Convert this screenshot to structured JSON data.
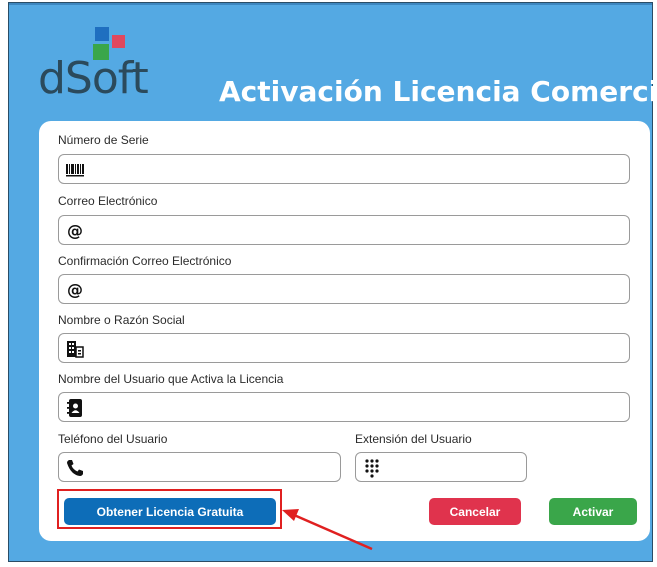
{
  "header": {
    "logo_text": "dSoft",
    "title": "Activación Licencia Comercial"
  },
  "form": {
    "serial": {
      "label": "Número de Serie",
      "value": "",
      "icon": "barcode-icon"
    },
    "email": {
      "label": "Correo Electrónico",
      "value": "",
      "icon": "at-icon"
    },
    "email_confirm": {
      "label": "Confirmación Correo Electrónico",
      "value": "",
      "icon": "at-icon"
    },
    "company": {
      "label": "Nombre o Razón Social",
      "value": "",
      "icon": "building-icon"
    },
    "user_name": {
      "label": "Nombre del Usuario que Activa la Licencia",
      "value": "",
      "icon": "address-book-icon"
    },
    "phone": {
      "label": "Teléfono del Usuario",
      "value": "",
      "icon": "phone-icon"
    },
    "extension": {
      "label": "Extensión del Usuario",
      "value": "",
      "icon": "keypad-icon"
    }
  },
  "buttons": {
    "free_license": "Obtener Licencia Gratuita",
    "cancel": "Cancelar",
    "activate": "Activar"
  },
  "colors": {
    "background": "#54a9e3",
    "primary_button": "#0d6db8",
    "cancel_button": "#e0334d",
    "activate_button": "#3aa64a",
    "annotation": "#e02020"
  }
}
